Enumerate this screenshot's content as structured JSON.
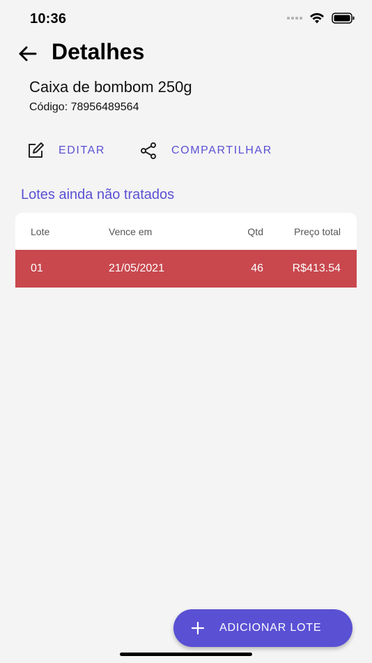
{
  "status_bar": {
    "time": "10:36"
  },
  "header": {
    "title": "Detalhes",
    "back_icon": "arrow-left-icon"
  },
  "product": {
    "name": "Caixa de bombom 250g",
    "code": "Código: 78956489564"
  },
  "actions": {
    "edit_label": "EDITAR",
    "edit_icon": "edit-icon",
    "share_label": "COMPARTILHAR",
    "share_icon": "share-icon"
  },
  "section": {
    "title": "Lotes ainda não tratados"
  },
  "table": {
    "columns": [
      "Lote",
      "Vence em",
      "Qtd",
      "Preço total"
    ],
    "rows": [
      {
        "lote": "01",
        "vence": "21/05/2021",
        "qtd": "46",
        "preco": "R$413.54"
      }
    ],
    "row_color": "#c8484e"
  },
  "fab": {
    "label": "ADICIONAR LOTE",
    "icon": "plus-icon"
  },
  "colors": {
    "accent": "#5a50d4",
    "background": "#f4f4f4"
  }
}
